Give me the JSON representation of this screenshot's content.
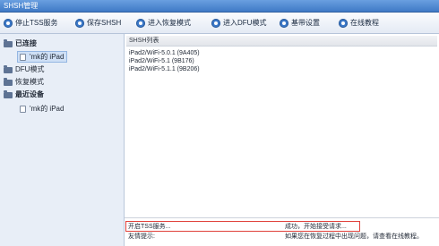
{
  "window": {
    "title": "SHSH管理"
  },
  "toolbar": {
    "buttons": [
      {
        "label": "停止TSS服务",
        "icon": "stop-service-icon"
      },
      {
        "label": "保存SHSH",
        "icon": "save-icon"
      },
      {
        "label": "进入恢复模式",
        "icon": "recovery-mode-icon"
      },
      {
        "label": "进入DFU模式",
        "icon": "dfu-mode-icon"
      },
      {
        "label": "基带设置",
        "icon": "baseband-settings-icon"
      },
      {
        "label": "在线教程",
        "icon": "online-tutorial-icon"
      }
    ]
  },
  "sidebar": {
    "items": [
      {
        "label": "已连接",
        "icon": "folder-icon"
      },
      {
        "label": "'mk的 iPad",
        "icon": "ipad-icon",
        "selected": true
      },
      {
        "label": "DFU模式",
        "icon": "folder-icon"
      },
      {
        "label": "恢复模式",
        "icon": "folder-icon"
      },
      {
        "label": "最近设备",
        "icon": "folder-icon"
      },
      {
        "label": "'mk的 iPad",
        "icon": "ipad-icon"
      }
    ]
  },
  "shsh_list": {
    "header": "SHSH列表",
    "rows": [
      "iPad2/WiFi-5.0.1 (9A405)",
      "iPad2/WiFi-5.1 (9B176)",
      "iPad2/WiFi-5.1.1 (9B206)"
    ]
  },
  "log": {
    "rows": [
      {
        "message": "开启TSS服务...",
        "status": "成功，开始接受请求..."
      },
      {
        "message": "友情提示:",
        "status": "如果您在恢复过程中出现问题，请查看在线教程。"
      }
    ]
  },
  "colors": {
    "titlebar": "#3f7ac6",
    "toolbar_icon": "#3b78c8",
    "sidebar_bg": "#e8eef7",
    "selection": "#cfe0f6",
    "highlight_box": "#e0403a"
  }
}
